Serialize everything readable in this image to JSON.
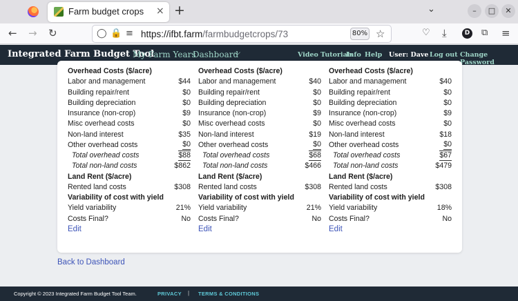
{
  "browser": {
    "tab_title": "Farm budget crops",
    "tab_close": "×",
    "new_tab": "+",
    "url_host": "https://ifbt.farm",
    "url_path": "/farmbudgetcrops/73",
    "zoom": "80%",
    "profile_initial": "D"
  },
  "header": {
    "brand": "Integrated Farm Budget Tool",
    "nav_my_farm_years": "My Farm Years",
    "nav_dashboard": "Dashboard",
    "nav_dashboard_caret": "⌵",
    "video_tutorials": "Video Tutorials",
    "info": "Info",
    "help": "Help",
    "user": "User: Dave",
    "logout": "Log out",
    "change_password": "Change Password"
  },
  "columns": [
    {
      "overhead_heading": "Overhead Costs ($/acre)",
      "labor_label": "Labor and management",
      "labor": "$44",
      "repair_label": "Building repair/rent",
      "repair": "$0",
      "depr_label": "Building depreciation",
      "depr": "$0",
      "ins_label": "Insurance (non-crop)",
      "ins": "$9",
      "misc_label": "Misc overhead costs",
      "misc": "$0",
      "nli_label": "Non-land interest",
      "nli": "$35",
      "other_label": "Other overhead costs",
      "other": "$0",
      "tot_oh_label": "Total overhead costs",
      "tot_oh": "$88",
      "tot_nl_label": "Total non-land costs",
      "tot_nl": "$862",
      "rent_heading": "Land Rent ($/acre)",
      "rent_label": "Rented land costs",
      "rent": "$308",
      "var_heading": "Variability of cost with yield",
      "yv_label": "Yield variability",
      "yv": "21%",
      "cf_label": "Costs Final?",
      "cf": "No",
      "edit": "Edit"
    },
    {
      "overhead_heading": "Overhead Costs ($/acre)",
      "labor_label": "Labor and management",
      "labor": "$40",
      "repair_label": "Building repair/rent",
      "repair": "$0",
      "depr_label": "Building depreciation",
      "depr": "$0",
      "ins_label": "Insurance (non-crop)",
      "ins": "$9",
      "misc_label": "Misc overhead costs",
      "misc": "$0",
      "nli_label": "Non-land interest",
      "nli": "$19",
      "other_label": "Other overhead costs",
      "other": "$0",
      "tot_oh_label": "Total overhead costs",
      "tot_oh": "$68",
      "tot_nl_label": "Total non-land costs",
      "tot_nl": "$466",
      "rent_heading": "Land Rent ($/acre)",
      "rent_label": "Rented land costs",
      "rent": "$308",
      "var_heading": "Variability of cost with yield",
      "yv_label": "Yield variability",
      "yv": "21%",
      "cf_label": "Costs Final?",
      "cf": "No",
      "edit": "Edit"
    },
    {
      "overhead_heading": "Overhead Costs ($/acre)",
      "labor_label": "Labor and management",
      "labor": "$40",
      "repair_label": "Building repair/rent",
      "repair": "$0",
      "depr_label": "Building depreciation",
      "depr": "$0",
      "ins_label": "Insurance (non-crop)",
      "ins": "$9",
      "misc_label": "Misc overhead costs",
      "misc": "$0",
      "nli_label": "Non-land interest",
      "nli": "$18",
      "other_label": "Other overhead costs",
      "other": "$0",
      "tot_oh_label": "Total overhead costs",
      "tot_oh": "$67",
      "tot_nl_label": "Total non-land costs",
      "tot_nl": "$479",
      "rent_heading": "Land Rent ($/acre)",
      "rent_label": "Rented land costs",
      "rent": "$308",
      "var_heading": "Variability of cost with yield",
      "yv_label": "Yield variability",
      "yv": "18%",
      "cf_label": "Costs Final?",
      "cf": "No",
      "edit": "Edit"
    }
  ],
  "back_link": "Back to Dashboard",
  "footer": {
    "copyright": "Copyright © 2023 Integrated Farm Budget Tool Team.",
    "privacy": "PRIVACY",
    "separator": "|",
    "terms": "TERMS & CONDITIONS"
  }
}
